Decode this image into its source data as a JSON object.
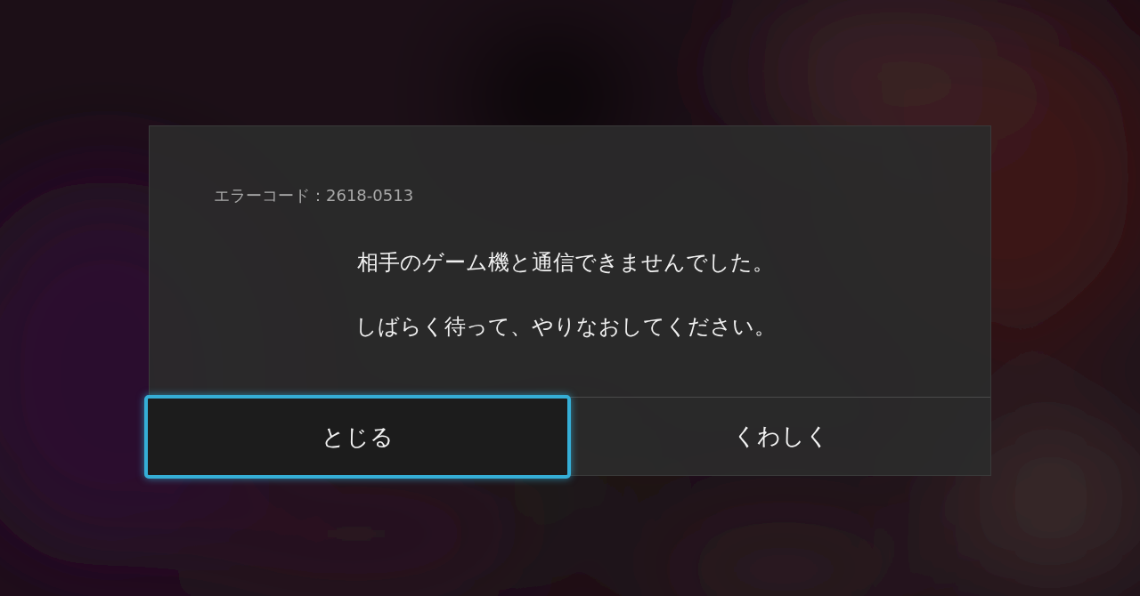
{
  "dialog": {
    "error_code": "エラーコード：2618-0513",
    "messages": [
      "相手のゲーム機と通信できませんでした。",
      "しばらく待って、やりなおしてください。"
    ],
    "buttons": [
      {
        "label": "とじる",
        "selected": true
      },
      {
        "label": "くわしく",
        "selected": false
      }
    ]
  }
}
